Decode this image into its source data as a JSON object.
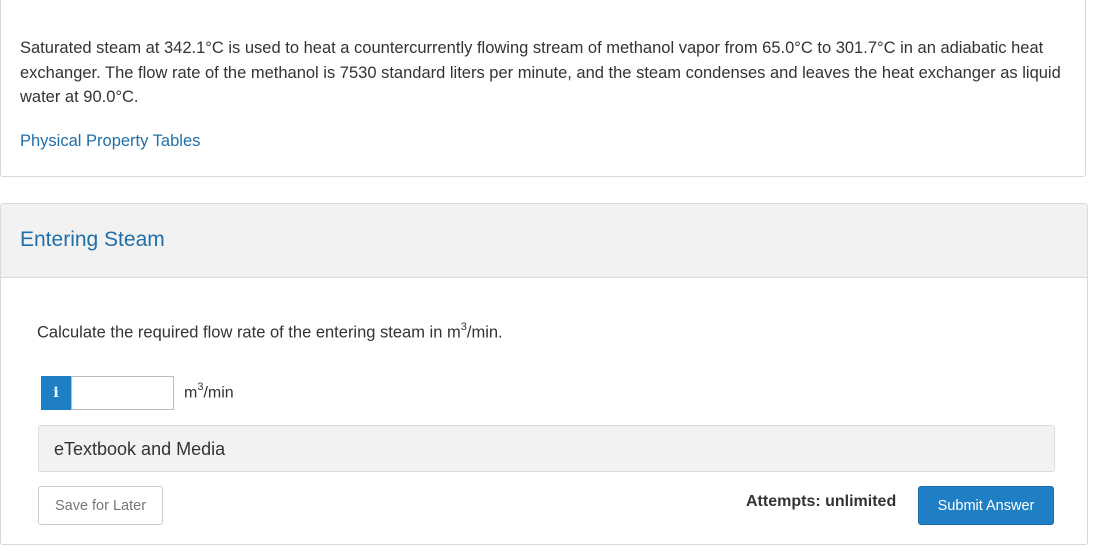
{
  "problem": {
    "statement": "Saturated steam at 342.1°C is used to heat a countercurrently flowing stream of methanol vapor from 65.0°C to 301.7°C in an adiabatic heat exchanger. The flow rate of the methanol is 7530 standard liters per minute, and the steam condenses and leaves the heat exchanger as liquid water at 90.0°C.",
    "property_link": "Physical Property Tables"
  },
  "part": {
    "title": "Entering Steam",
    "question_prefix": "Calculate the required flow rate of the entering steam in m",
    "question_exponent": "3",
    "question_suffix": "/min.",
    "info_icon": "i",
    "answer_value": "",
    "unit_base": "m",
    "unit_exponent": "3",
    "unit_suffix": "/min",
    "etextbook_label": "eTextbook and Media",
    "save_label": "Save for Later",
    "attempts_label": "Attempts: unlimited",
    "submit_label": "Submit Answer"
  },
  "colors": {
    "link": "#1f6fa8",
    "primary_button": "#1f7fc4",
    "header_background": "#f2f2f2"
  }
}
